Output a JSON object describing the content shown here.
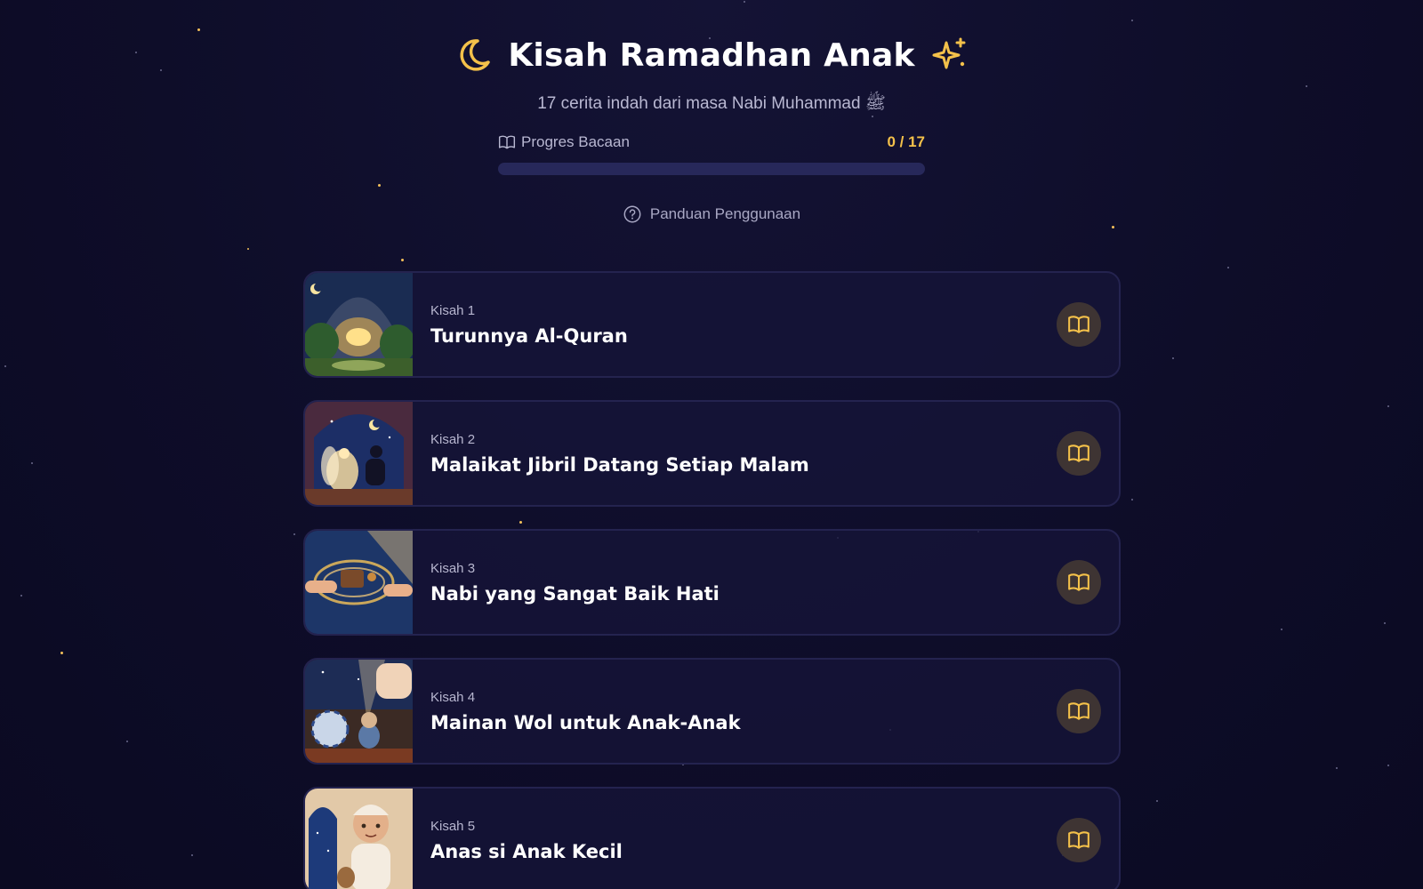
{
  "header": {
    "title": "Kisah Ramadhan Anak",
    "subtitle": "17 cerita indah dari masa Nabi Muhammad ﷺ"
  },
  "progress": {
    "label": "Progres Bacaan",
    "count_text": "0 / 17",
    "fraction": 0
  },
  "guide": {
    "label": "Panduan Penggunaan"
  },
  "stories": [
    {
      "number_label": "Kisah 1",
      "title": "Turunnya Al-Quran",
      "thumbnail": "glowing-quran-in-cave"
    },
    {
      "number_label": "Kisah 2",
      "title": "Malaikat Jibril Datang Setiap Malam",
      "thumbnail": "angel-and-prophet-at-night"
    },
    {
      "number_label": "Kisah 3",
      "title": "Nabi yang Sangat Baik Hati",
      "thumbnail": "hands-sharing-gift"
    },
    {
      "number_label": "Kisah 4",
      "title": "Mainan Wol untuk Anak-Anak",
      "thumbnail": "wool-toy-by-window"
    },
    {
      "number_label": "Kisah 5",
      "title": "Anas si Anak Kecil",
      "thumbnail": "boy-with-cap"
    }
  ],
  "icons": {
    "title_left": "moon-icon",
    "title_right": "sparkles-icon",
    "progress": "open-book-icon",
    "guide": "help-circle-icon",
    "card_action": "open-book-icon"
  },
  "colors": {
    "background": "#0f0e2b",
    "accent": "#f4c14a",
    "card_border": "#24234f",
    "button_bg": "#3e3433"
  }
}
